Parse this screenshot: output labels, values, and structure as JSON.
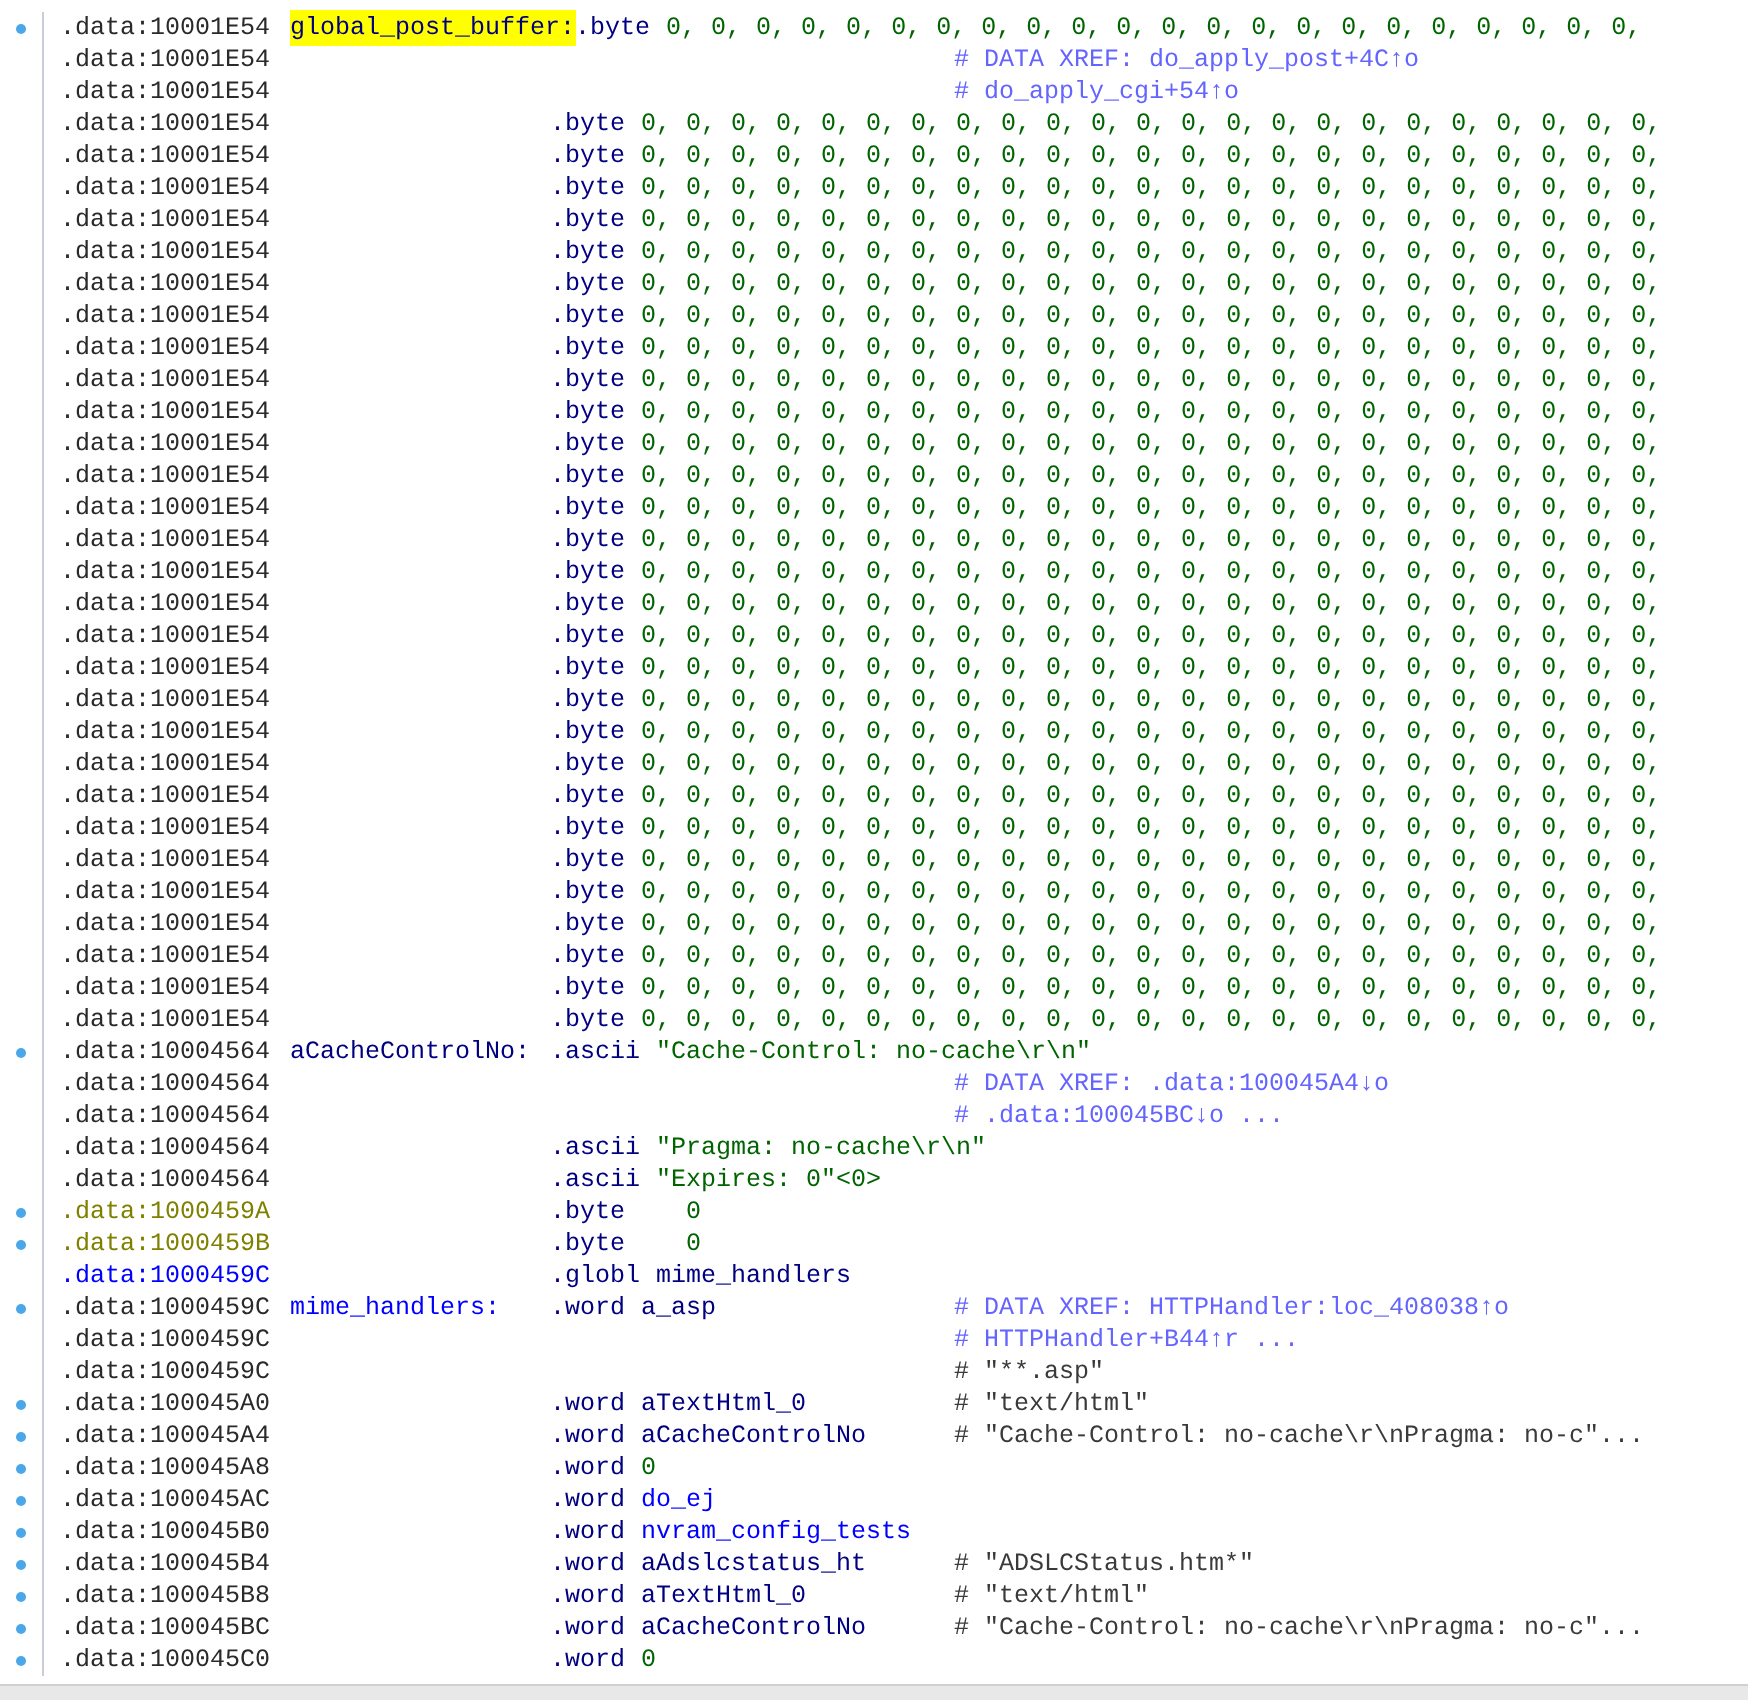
{
  "lines": [
    {
      "dot": true,
      "parts": [
        {
          "kind": "address",
          "text": ".data:10001E54"
        },
        {
          "kind": "label",
          "text": "global_post_buffer:",
          "highlighted": true
        },
        {
          "kind": "mnemonic",
          "text": ".byte"
        },
        {
          "kind": "number",
          "text": "0, 0, 0, 0, 0, 0, 0, 0, 0, 0, 0, 0, 0, 0, 0, 0, 0, 0, 0, 0, 0, 0,"
        }
      ]
    },
    {
      "dot": false,
      "parts": [
        {
          "kind": "address",
          "text": ".data:10001E54"
        },
        {
          "kind": "xref",
          "text": "# DATA XREF: do_apply_post+4C↑o"
        }
      ]
    },
    {
      "dot": false,
      "parts": [
        {
          "kind": "address",
          "text": ".data:10001E54"
        },
        {
          "kind": "xref",
          "text": "# do_apply_cgi+54↑o"
        }
      ]
    },
    {
      "dot": false,
      "parts": [
        {
          "kind": "address",
          "text": ".data:10001E54"
        },
        {
          "kind": "mnemonic",
          "text": ".byte"
        },
        {
          "kind": "number",
          "text": "0, 0, 0, 0, 0, 0, 0, 0, 0, 0, 0, 0, 0, 0, 0, 0, 0, 0, 0, 0, 0, 0, 0,"
        }
      ]
    },
    {
      "dot": false,
      "parts": [
        {
          "kind": "address",
          "text": ".data:10001E54"
        },
        {
          "kind": "mnemonic",
          "text": ".byte"
        },
        {
          "kind": "number",
          "text": "0, 0, 0, 0, 0, 0, 0, 0, 0, 0, 0, 0, 0, 0, 0, 0, 0, 0, 0, 0, 0, 0, 0,"
        }
      ]
    },
    {
      "dot": false,
      "parts": [
        {
          "kind": "address",
          "text": ".data:10001E54"
        },
        {
          "kind": "mnemonic",
          "text": ".byte"
        },
        {
          "kind": "number",
          "text": "0, 0, 0, 0, 0, 0, 0, 0, 0, 0, 0, 0, 0, 0, 0, 0, 0, 0, 0, 0, 0, 0, 0,"
        }
      ]
    },
    {
      "dot": false,
      "parts": [
        {
          "kind": "address",
          "text": ".data:10001E54"
        },
        {
          "kind": "mnemonic",
          "text": ".byte"
        },
        {
          "kind": "number",
          "text": "0, 0, 0, 0, 0, 0, 0, 0, 0, 0, 0, 0, 0, 0, 0, 0, 0, 0, 0, 0, 0, 0, 0,"
        }
      ]
    },
    {
      "dot": false,
      "parts": [
        {
          "kind": "address",
          "text": ".data:10001E54"
        },
        {
          "kind": "mnemonic",
          "text": ".byte"
        },
        {
          "kind": "number",
          "text": "0, 0, 0, 0, 0, 0, 0, 0, 0, 0, 0, 0, 0, 0, 0, 0, 0, 0, 0, 0, 0, 0, 0,"
        }
      ]
    },
    {
      "dot": false,
      "parts": [
        {
          "kind": "address",
          "text": ".data:10001E54"
        },
        {
          "kind": "mnemonic",
          "text": ".byte"
        },
        {
          "kind": "number",
          "text": "0, 0, 0, 0, 0, 0, 0, 0, 0, 0, 0, 0, 0, 0, 0, 0, 0, 0, 0, 0, 0, 0, 0,"
        }
      ]
    },
    {
      "dot": false,
      "parts": [
        {
          "kind": "address",
          "text": ".data:10001E54"
        },
        {
          "kind": "mnemonic",
          "text": ".byte"
        },
        {
          "kind": "number",
          "text": "0, 0, 0, 0, 0, 0, 0, 0, 0, 0, 0, 0, 0, 0, 0, 0, 0, 0, 0, 0, 0, 0, 0,"
        }
      ]
    },
    {
      "dot": false,
      "parts": [
        {
          "kind": "address",
          "text": ".data:10001E54"
        },
        {
          "kind": "mnemonic",
          "text": ".byte"
        },
        {
          "kind": "number",
          "text": "0, 0, 0, 0, 0, 0, 0, 0, 0, 0, 0, 0, 0, 0, 0, 0, 0, 0, 0, 0, 0, 0, 0,"
        }
      ]
    },
    {
      "dot": false,
      "parts": [
        {
          "kind": "address",
          "text": ".data:10001E54"
        },
        {
          "kind": "mnemonic",
          "text": ".byte"
        },
        {
          "kind": "number",
          "text": "0, 0, 0, 0, 0, 0, 0, 0, 0, 0, 0, 0, 0, 0, 0, 0, 0, 0, 0, 0, 0, 0, 0,"
        }
      ]
    },
    {
      "dot": false,
      "parts": [
        {
          "kind": "address",
          "text": ".data:10001E54"
        },
        {
          "kind": "mnemonic",
          "text": ".byte"
        },
        {
          "kind": "number",
          "text": "0, 0, 0, 0, 0, 0, 0, 0, 0, 0, 0, 0, 0, 0, 0, 0, 0, 0, 0, 0, 0, 0, 0,"
        }
      ]
    },
    {
      "dot": false,
      "parts": [
        {
          "kind": "address",
          "text": ".data:10001E54"
        },
        {
          "kind": "mnemonic",
          "text": ".byte"
        },
        {
          "kind": "number",
          "text": "0, 0, 0, 0, 0, 0, 0, 0, 0, 0, 0, 0, 0, 0, 0, 0, 0, 0, 0, 0, 0, 0, 0,"
        }
      ]
    },
    {
      "dot": false,
      "parts": [
        {
          "kind": "address",
          "text": ".data:10001E54"
        },
        {
          "kind": "mnemonic",
          "text": ".byte"
        },
        {
          "kind": "number",
          "text": "0, 0, 0, 0, 0, 0, 0, 0, 0, 0, 0, 0, 0, 0, 0, 0, 0, 0, 0, 0, 0, 0, 0,"
        }
      ]
    },
    {
      "dot": false,
      "parts": [
        {
          "kind": "address",
          "text": ".data:10001E54"
        },
        {
          "kind": "mnemonic",
          "text": ".byte"
        },
        {
          "kind": "number",
          "text": "0, 0, 0, 0, 0, 0, 0, 0, 0, 0, 0, 0, 0, 0, 0, 0, 0, 0, 0, 0, 0, 0, 0,"
        }
      ]
    },
    {
      "dot": false,
      "parts": [
        {
          "kind": "address",
          "text": ".data:10001E54"
        },
        {
          "kind": "mnemonic",
          "text": ".byte"
        },
        {
          "kind": "number",
          "text": "0, 0, 0, 0, 0, 0, 0, 0, 0, 0, 0, 0, 0, 0, 0, 0, 0, 0, 0, 0, 0, 0, 0,"
        }
      ]
    },
    {
      "dot": false,
      "parts": [
        {
          "kind": "address",
          "text": ".data:10001E54"
        },
        {
          "kind": "mnemonic",
          "text": ".byte"
        },
        {
          "kind": "number",
          "text": "0, 0, 0, 0, 0, 0, 0, 0, 0, 0, 0, 0, 0, 0, 0, 0, 0, 0, 0, 0, 0, 0, 0,"
        }
      ]
    },
    {
      "dot": false,
      "parts": [
        {
          "kind": "address",
          "text": ".data:10001E54"
        },
        {
          "kind": "mnemonic",
          "text": ".byte"
        },
        {
          "kind": "number",
          "text": "0, 0, 0, 0, 0, 0, 0, 0, 0, 0, 0, 0, 0, 0, 0, 0, 0, 0, 0, 0, 0, 0, 0,"
        }
      ]
    },
    {
      "dot": false,
      "parts": [
        {
          "kind": "address",
          "text": ".data:10001E54"
        },
        {
          "kind": "mnemonic",
          "text": ".byte"
        },
        {
          "kind": "number",
          "text": "0, 0, 0, 0, 0, 0, 0, 0, 0, 0, 0, 0, 0, 0, 0, 0, 0, 0, 0, 0, 0, 0, 0,"
        }
      ]
    },
    {
      "dot": false,
      "parts": [
        {
          "kind": "address",
          "text": ".data:10001E54"
        },
        {
          "kind": "mnemonic",
          "text": ".byte"
        },
        {
          "kind": "number",
          "text": "0, 0, 0, 0, 0, 0, 0, 0, 0, 0, 0, 0, 0, 0, 0, 0, 0, 0, 0, 0, 0, 0, 0,"
        }
      ]
    },
    {
      "dot": false,
      "parts": [
        {
          "kind": "address",
          "text": ".data:10001E54"
        },
        {
          "kind": "mnemonic",
          "text": ".byte"
        },
        {
          "kind": "number",
          "text": "0, 0, 0, 0, 0, 0, 0, 0, 0, 0, 0, 0, 0, 0, 0, 0, 0, 0, 0, 0, 0, 0, 0,"
        }
      ]
    },
    {
      "dot": false,
      "parts": [
        {
          "kind": "address",
          "text": ".data:10001E54"
        },
        {
          "kind": "mnemonic",
          "text": ".byte"
        },
        {
          "kind": "number",
          "text": "0, 0, 0, 0, 0, 0, 0, 0, 0, 0, 0, 0, 0, 0, 0, 0, 0, 0, 0, 0, 0, 0, 0,"
        }
      ]
    },
    {
      "dot": false,
      "parts": [
        {
          "kind": "address",
          "text": ".data:10001E54"
        },
        {
          "kind": "mnemonic",
          "text": ".byte"
        },
        {
          "kind": "number",
          "text": "0, 0, 0, 0, 0, 0, 0, 0, 0, 0, 0, 0, 0, 0, 0, 0, 0, 0, 0, 0, 0, 0, 0,"
        }
      ]
    },
    {
      "dot": false,
      "parts": [
        {
          "kind": "address",
          "text": ".data:10001E54"
        },
        {
          "kind": "mnemonic",
          "text": ".byte"
        },
        {
          "kind": "number",
          "text": "0, 0, 0, 0, 0, 0, 0, 0, 0, 0, 0, 0, 0, 0, 0, 0, 0, 0, 0, 0, 0, 0, 0,"
        }
      ]
    },
    {
      "dot": false,
      "parts": [
        {
          "kind": "address",
          "text": ".data:10001E54"
        },
        {
          "kind": "mnemonic",
          "text": ".byte"
        },
        {
          "kind": "number",
          "text": "0, 0, 0, 0, 0, 0, 0, 0, 0, 0, 0, 0, 0, 0, 0, 0, 0, 0, 0, 0, 0, 0, 0,"
        }
      ]
    },
    {
      "dot": false,
      "parts": [
        {
          "kind": "address",
          "text": ".data:10001E54"
        },
        {
          "kind": "mnemonic",
          "text": ".byte"
        },
        {
          "kind": "number",
          "text": "0, 0, 0, 0, 0, 0, 0, 0, 0, 0, 0, 0, 0, 0, 0, 0, 0, 0, 0, 0, 0, 0, 0,"
        }
      ]
    },
    {
      "dot": false,
      "parts": [
        {
          "kind": "address",
          "text": ".data:10001E54"
        },
        {
          "kind": "mnemonic",
          "text": ".byte"
        },
        {
          "kind": "number",
          "text": "0, 0, 0, 0, 0, 0, 0, 0, 0, 0, 0, 0, 0, 0, 0, 0, 0, 0, 0, 0, 0, 0, 0,"
        }
      ]
    },
    {
      "dot": false,
      "parts": [
        {
          "kind": "address",
          "text": ".data:10001E54"
        },
        {
          "kind": "mnemonic",
          "text": ".byte"
        },
        {
          "kind": "number",
          "text": "0, 0, 0, 0, 0, 0, 0, 0, 0, 0, 0, 0, 0, 0, 0, 0, 0, 0, 0, 0, 0, 0, 0,"
        }
      ]
    },
    {
      "dot": false,
      "parts": [
        {
          "kind": "address",
          "text": ".data:10001E54"
        },
        {
          "kind": "mnemonic",
          "text": ".byte"
        },
        {
          "kind": "number",
          "text": "0, 0, 0, 0, 0, 0, 0, 0, 0, 0, 0, 0, 0, 0, 0, 0, 0, 0, 0, 0, 0, 0, 0,"
        }
      ]
    },
    {
      "dot": false,
      "parts": [
        {
          "kind": "address",
          "text": ".data:10001E54"
        },
        {
          "kind": "mnemonic",
          "text": ".byte"
        },
        {
          "kind": "number",
          "text": "0, 0, 0, 0, 0, 0, 0, 0, 0, 0, 0, 0, 0, 0, 0, 0, 0, 0, 0, 0, 0, 0, 0,"
        }
      ]
    },
    {
      "dot": false,
      "parts": [
        {
          "kind": "address",
          "text": ".data:10001E54"
        },
        {
          "kind": "mnemonic",
          "text": ".byte"
        },
        {
          "kind": "number",
          "text": "0, 0, 0, 0, 0, 0, 0, 0, 0, 0, 0, 0, 0, 0, 0, 0, 0, 0, 0, 0, 0, 0, 0,"
        }
      ]
    },
    {
      "dot": true,
      "parts": [
        {
          "kind": "address",
          "text": ".data:10004564"
        },
        {
          "kind": "label",
          "text": "aCacheControlNo:",
          "highlighted": false
        },
        {
          "kind": "mnemonic",
          "text": ".ascii"
        },
        {
          "kind": "string",
          "text": "\"Cache-Control: no-cache\\r\\n\""
        }
      ]
    },
    {
      "dot": false,
      "parts": [
        {
          "kind": "address",
          "text": ".data:10004564"
        },
        {
          "kind": "xref",
          "text": "# DATA XREF: .data:100045A4↓o"
        }
      ]
    },
    {
      "dot": false,
      "parts": [
        {
          "kind": "address",
          "text": ".data:10004564"
        },
        {
          "kind": "xref",
          "text": "# .data:100045BC↓o ..."
        }
      ]
    },
    {
      "dot": false,
      "parts": [
        {
          "kind": "address",
          "text": ".data:10004564"
        },
        {
          "kind": "mnemonic",
          "text": ".ascii"
        },
        {
          "kind": "string",
          "text": "\"Pragma: no-cache\\r\\n\""
        }
      ]
    },
    {
      "dot": false,
      "parts": [
        {
          "kind": "address",
          "text": ".data:10004564"
        },
        {
          "kind": "mnemonic",
          "text": ".ascii"
        },
        {
          "kind": "string",
          "text": "\"Expires: 0\"<0>"
        }
      ]
    },
    {
      "dot": true,
      "parts": [
        {
          "kind": "unexplored",
          "text": ".data:1000459A"
        },
        {
          "kind": "mnemonic",
          "text": ".byte"
        },
        {
          "kind": "number",
          "text": "   0"
        }
      ]
    },
    {
      "dot": true,
      "parts": [
        {
          "kind": "unexplored",
          "text": ".data:1000459B"
        },
        {
          "kind": "mnemonic",
          "text": ".byte"
        },
        {
          "kind": "number",
          "text": "   0"
        }
      ]
    },
    {
      "dot": false,
      "parts": [
        {
          "kind": "exported",
          "text": ".data:1000459C"
        },
        {
          "kind": "mnemonic",
          "text": ".globl"
        },
        {
          "kind": "name",
          "text": "mime_handlers"
        }
      ]
    },
    {
      "dot": true,
      "parts": [
        {
          "kind": "address",
          "text": ".data:1000459C"
        },
        {
          "kind": "entry",
          "text": "mime_handlers:",
          "highlighted": false
        },
        {
          "kind": "mnemonic",
          "text": ".word"
        },
        {
          "kind": "name",
          "text": "a_asp"
        },
        {
          "kind": "xref",
          "text": "# DATA XREF: HTTPHandler:loc_408038↑o"
        }
      ]
    },
    {
      "dot": false,
      "parts": [
        {
          "kind": "address",
          "text": ".data:1000459C"
        },
        {
          "kind": "xref",
          "text": "# HTTPHandler+B44↑r ..."
        }
      ]
    },
    {
      "dot": false,
      "parts": [
        {
          "kind": "address",
          "text": ".data:1000459C"
        },
        {
          "kind": "note",
          "text": "# \"**.asp\""
        }
      ]
    },
    {
      "dot": true,
      "parts": [
        {
          "kind": "address",
          "text": ".data:100045A0"
        },
        {
          "kind": "mnemonic",
          "text": ".word"
        },
        {
          "kind": "name",
          "text": "aTextHtml_0"
        },
        {
          "kind": "note",
          "text": "# \"text/html\""
        }
      ]
    },
    {
      "dot": true,
      "parts": [
        {
          "kind": "address",
          "text": ".data:100045A4"
        },
        {
          "kind": "mnemonic",
          "text": ".word"
        },
        {
          "kind": "name",
          "text": "aCacheControlNo"
        },
        {
          "kind": "note",
          "text": "# \"Cache-Control: no-cache\\r\\nPragma: no-c\"..."
        }
      ]
    },
    {
      "dot": true,
      "parts": [
        {
          "kind": "address",
          "text": ".data:100045A8"
        },
        {
          "kind": "mnemonic",
          "text": ".word"
        },
        {
          "kind": "number",
          "text": "0"
        }
      ]
    },
    {
      "dot": true,
      "parts": [
        {
          "kind": "address",
          "text": ".data:100045AC"
        },
        {
          "kind": "mnemonic",
          "text": ".word"
        },
        {
          "kind": "function",
          "text": "do_ej"
        }
      ]
    },
    {
      "dot": true,
      "parts": [
        {
          "kind": "address",
          "text": ".data:100045B0"
        },
        {
          "kind": "mnemonic",
          "text": ".word"
        },
        {
          "kind": "function",
          "text": "nvram_config_tests"
        }
      ]
    },
    {
      "dot": true,
      "parts": [
        {
          "kind": "address",
          "text": ".data:100045B4"
        },
        {
          "kind": "mnemonic",
          "text": ".word"
        },
        {
          "kind": "name",
          "text": "aAdslcstatus_ht"
        },
        {
          "kind": "note",
          "text": "# \"ADSLCStatus.htm*\""
        }
      ]
    },
    {
      "dot": true,
      "parts": [
        {
          "kind": "address",
          "text": ".data:100045B8"
        },
        {
          "kind": "mnemonic",
          "text": ".word"
        },
        {
          "kind": "name",
          "text": "aTextHtml_0"
        },
        {
          "kind": "note",
          "text": "# \"text/html\""
        }
      ]
    },
    {
      "dot": true,
      "parts": [
        {
          "kind": "address",
          "text": ".data:100045BC"
        },
        {
          "kind": "mnemonic",
          "text": ".word"
        },
        {
          "kind": "name",
          "text": "aCacheControlNo"
        },
        {
          "kind": "note",
          "text": "# \"Cache-Control: no-cache\\r\\nPragma: no-c\"..."
        }
      ]
    },
    {
      "dot": true,
      "parts": [
        {
          "kind": "address",
          "text": ".data:100045C0"
        },
        {
          "kind": "mnemonic",
          "text": ".word"
        },
        {
          "kind": "number",
          "text": "0"
        }
      ]
    }
  ]
}
